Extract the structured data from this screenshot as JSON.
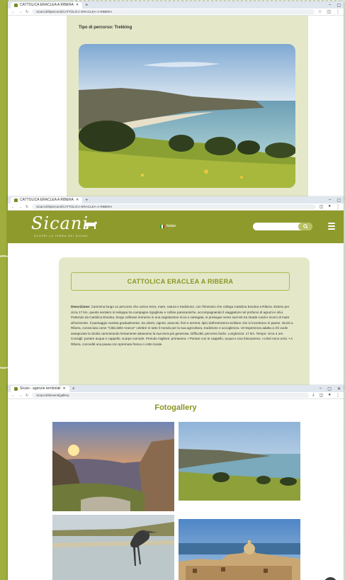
{
  "window1": {
    "tab_title": "CATTOLICA ERACLEA A RIBERA",
    "url": "sicani.it/it/percorsi/CATTOLICA-ERACLEA-A-RIBERA",
    "tipo_percorso": "Tipo di percorso: Trekking"
  },
  "window2": {
    "tab_title": "CATTOLICA ERACLEA A RIBERA",
    "url": "sicani.it/it/percorsi/CATTOLICA-ERACLEA-A-RIBERA",
    "logo_text": "Sicani",
    "logo_subtitle": "SCOPRI LA TERRA DEI SICANI",
    "language": "Italian",
    "page_title": "CATTOLICA ERACLEA A RIBERA",
    "description_label": "Descrizione:",
    "description_text": "Cammina lungo un percorso che unisce terra, mare, natura e tradizione, con l'itinerario che collega Cattolica Eraclea a Ribera. Esteso per circa 17 km, questo sentiero si sviluppa tra campagne rigogliose e colline panoramiche, accompagnando il viaggiatore nel profumo di agrumi e ulivi. Partendo da Cattolica Eraclea, borgo collinare immerso in una vegetazione ricca e variegata, si prosegue verso sud-est tra strade rurali e scorci di mare all'orizzonte. Il paesaggio cambia gradualmente, tra uliveti, vigneti, aranceti, fiori e torrenti, tipici dell'entroterra siciliano che si incontrano in paese. Giunti a Ribera, conosciuta come \"Città delle Arance\" celebre in tutto il mondo per la sua agricoltura, tradizione e accoglienza. Un'esperienza adatta a chi vuole assaporare la Sicilia camminando lentamente attraverso la sua terra più generosa. Difficoltà: percorso facile. Lunghezza: 17 km. Tempo: circa 4 ore. Consigli: portare acqua e cappello, scarpe comode. Periodo migliore: primavera.",
    "note_text": "• Portare con te cappello, acqua e una fotocamera. I colori sono unici. • A Ribera, concediti una pausa con spremuta fresca o cotto locale."
  },
  "window3": {
    "tab_title": "Sicani - agenzie territoriali",
    "url": "sicani.it/it/eventi/gallery",
    "gallery_title": "Fotogallery"
  },
  "colors": {
    "olive": "#8f9a2d",
    "panel": "#e4e8c9",
    "title_green": "#8a9422"
  },
  "icons": [
    "favicon-icon",
    "close-icon",
    "plus-icon",
    "minimize-icon",
    "maximize-icon",
    "back-icon",
    "forward-icon",
    "reload-icon",
    "star-icon",
    "extension-icon",
    "profile-icon",
    "menu-icon",
    "search-icon",
    "hamburger-icon",
    "arrow-up-icon"
  ]
}
